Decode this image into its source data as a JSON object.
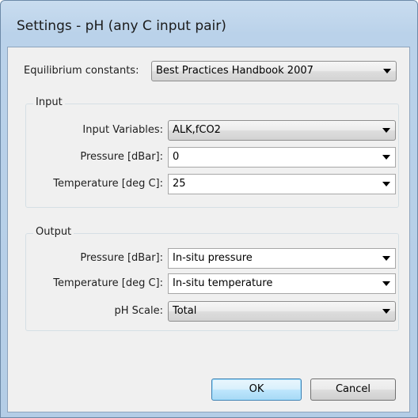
{
  "window": {
    "title": "Settings - pH (any C input pair)"
  },
  "equilibrium": {
    "label": "Equilibrium constants:",
    "value": "Best Practices Handbook 2007"
  },
  "input": {
    "group_title": "Input",
    "variables": {
      "label": "Input Variables:",
      "value": "ALK,fCO2"
    },
    "pressure": {
      "label": "Pressure [dBar]:",
      "value": "0"
    },
    "temperature": {
      "label": "Temperature [deg C]:",
      "value": "25"
    }
  },
  "output": {
    "group_title": "Output",
    "pressure": {
      "label": "Pressure [dBar]:",
      "value": "In-situ pressure"
    },
    "temperature": {
      "label": "Temperature [deg C]:",
      "value": "In-situ temperature"
    },
    "ph_scale": {
      "label": "pH Scale:",
      "value": "Total"
    }
  },
  "buttons": {
    "ok": "OK",
    "cancel": "Cancel"
  },
  "icons": {
    "dropdown": "chevron-down-icon"
  }
}
